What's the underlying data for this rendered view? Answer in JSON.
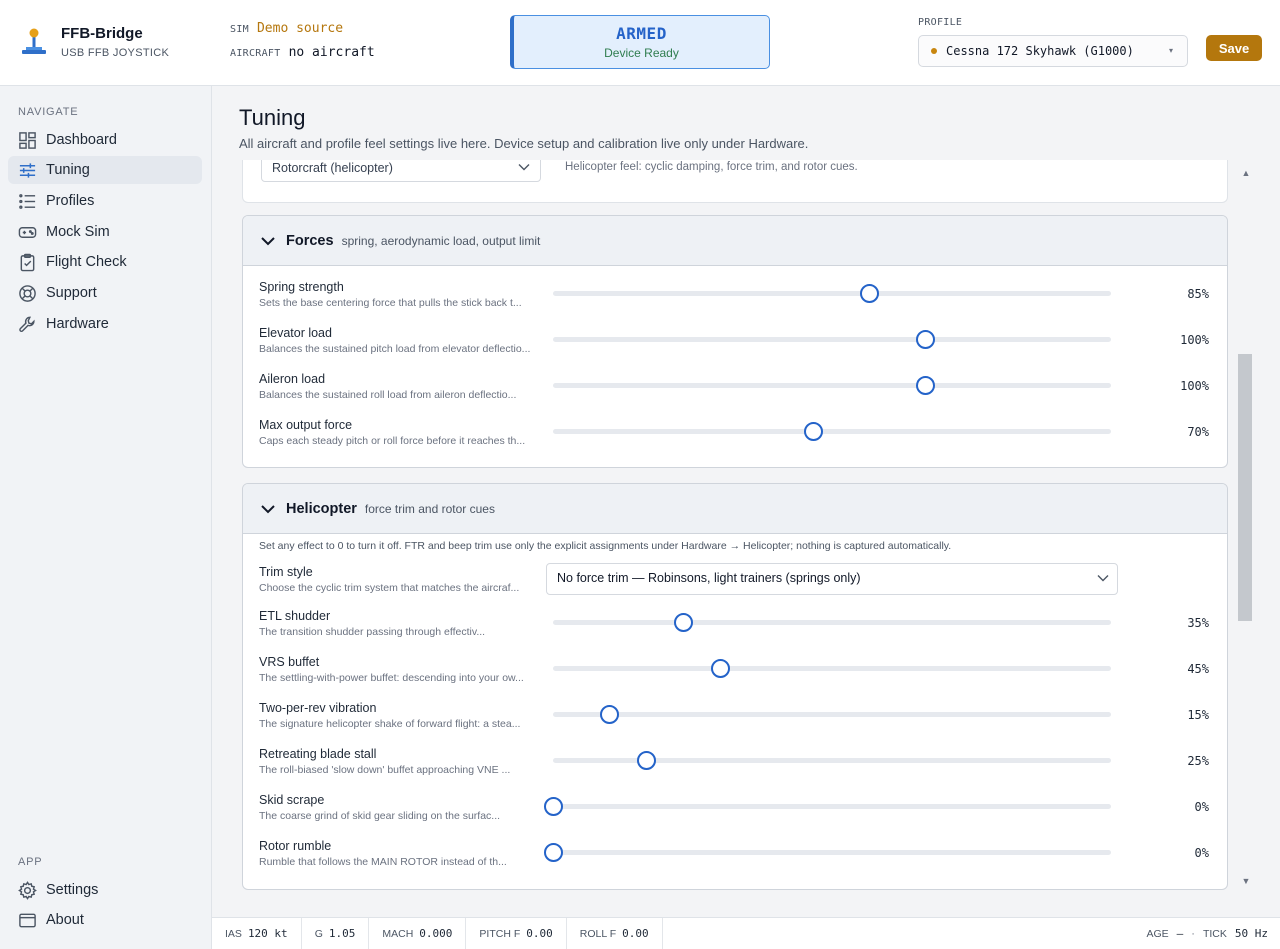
{
  "app": {
    "name": "FFB-Bridge",
    "subtitle": "USB FFB JOYSTICK"
  },
  "sidebar": {
    "navigate_heading": "NAVIGATE",
    "items": [
      {
        "label": "Dashboard",
        "icon": "dashboard-icon"
      },
      {
        "label": "Tuning",
        "icon": "sliders-icon",
        "active": true
      },
      {
        "label": "Profiles",
        "icon": "list-icon"
      },
      {
        "label": "Mock Sim",
        "icon": "gamepad-icon"
      },
      {
        "label": "Flight Check",
        "icon": "clipboard-check-icon"
      },
      {
        "label": "Support",
        "icon": "lifebuoy-icon"
      },
      {
        "label": "Hardware",
        "icon": "wrench-icon"
      }
    ],
    "app_heading": "APP",
    "app_items": [
      {
        "label": "Settings",
        "icon": "gear-icon"
      },
      {
        "label": "About",
        "icon": "window-icon"
      }
    ]
  },
  "header": {
    "sim_label": "SIM",
    "sim_value": "Demo source",
    "aircraft_label": "AIRCRAFT",
    "aircraft_value": "no aircraft",
    "status_title": "ARMED",
    "status_sub": "Device Ready",
    "profile_label": "PROFILE",
    "profile_value": "Cessna 172 Skyhawk (G1000)",
    "save_label": "Save",
    "accent": "#b4770d"
  },
  "main": {
    "title": "Tuning",
    "description": "All aircraft and profile feel settings live here. Device setup and calibration live only under Hardware.",
    "aircraft_type": {
      "select_value": "Rotorcraft (helicopter)",
      "description": "Helicopter feel: cyclic damping, force trim, and rotor cues."
    },
    "forces": {
      "title": "Forces",
      "subtitle": "spring, aerodynamic load, output limit",
      "rows": [
        {
          "label": "Spring strength",
          "hint": "Sets the base centering force that pulls the stick back t...",
          "value": 85,
          "display": "85%"
        },
        {
          "label": "Elevator load",
          "hint": "Balances the sustained pitch load from elevator deflectio...",
          "value": 100,
          "display": "100%"
        },
        {
          "label": "Aileron load",
          "hint": "Balances the sustained roll load from aileron deflectio...",
          "value": 100,
          "display": "100%"
        },
        {
          "label": "Max output force",
          "hint": "Caps each steady pitch or roll force before it reaches th...",
          "value": 70,
          "display": "70%"
        }
      ]
    },
    "helicopter": {
      "title": "Helicopter",
      "subtitle": "force trim and rotor cues",
      "note": "Set any effect to 0 to turn it off. FTR and beep trim use only the explicit assignments under Hardware → Helicopter; nothing is captured automatically.",
      "trim_label": "Trim style",
      "trim_hint": "Choose the cyclic trim system that matches the aircraf...",
      "trim_value": "No force trim — Robinsons, light trainers (springs only)",
      "rows": [
        {
          "label": "ETL shudder",
          "hint": "The transition shudder passing through effectiv...",
          "value": 35,
          "display": "35%"
        },
        {
          "label": "VRS buffet",
          "hint": "The settling-with-power buffet: descending into your ow...",
          "value": 45,
          "display": "45%"
        },
        {
          "label": "Two-per-rev vibration",
          "hint": "The signature helicopter shake of forward flight: a stea...",
          "value": 15,
          "display": "15%"
        },
        {
          "label": "Retreating blade stall",
          "hint": "The roll-biased 'slow down' buffet approaching VNE ...",
          "value": 25,
          "display": "25%"
        },
        {
          "label": "Skid scrape",
          "hint": "The coarse grind of skid gear sliding on the surfac...",
          "value": 0,
          "display": "0%"
        },
        {
          "label": "Rotor rumble",
          "hint": "Rumble that follows the MAIN ROTOR instead of th...",
          "value": 0,
          "display": "0%"
        }
      ]
    }
  },
  "footer": {
    "cells": [
      {
        "k": "IAS",
        "v": "120 kt"
      },
      {
        "k": "G",
        "v": "1.05"
      },
      {
        "k": "MACH",
        "v": "0.000"
      },
      {
        "k": "PITCH F",
        "v": "0.00"
      },
      {
        "k": "ROLL F",
        "v": "0.00"
      }
    ],
    "age_label": "AGE",
    "age_value": "—",
    "sep": "·",
    "tick_label": "TICK",
    "tick_value": "50 Hz"
  }
}
